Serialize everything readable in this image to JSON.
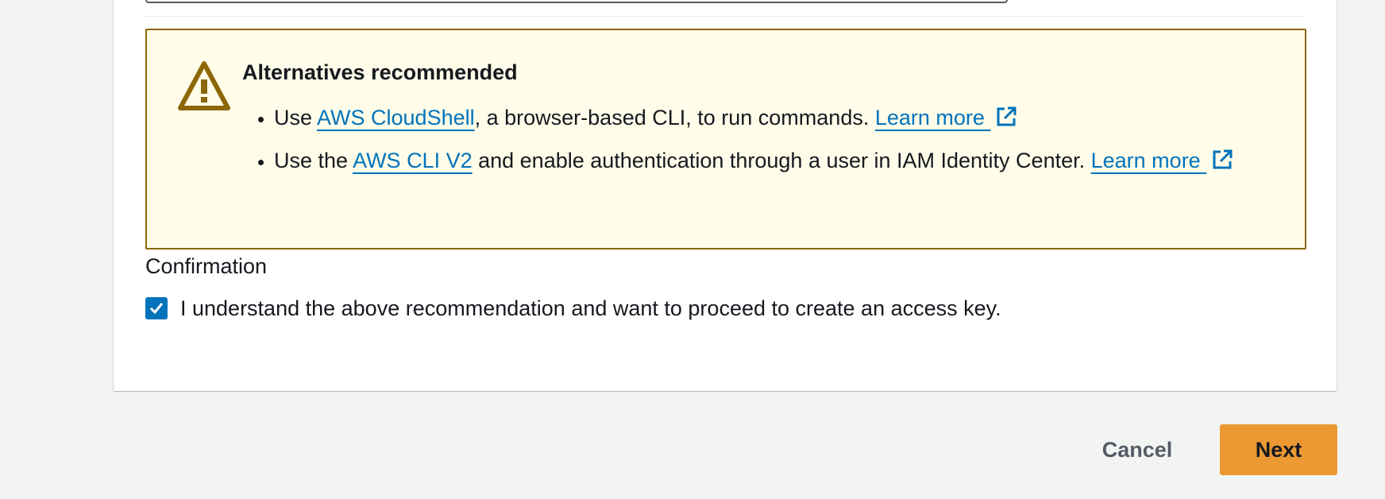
{
  "alert": {
    "icon": "warning-icon",
    "title": "Alternatives recommended",
    "item1": {
      "prefix": "Use ",
      "link": "AWS CloudShell",
      "suffix": ", a browser-based CLI, to run commands. ",
      "learn_more": "Learn more"
    },
    "item2": {
      "prefix": "Use the ",
      "link": "AWS CLI V2",
      "suffix": " and enable authentication through a user in IAM Identity Center. ",
      "learn_more": "Learn more"
    },
    "colors": {
      "background": "#fffce9",
      "border": "#8d6605",
      "link": "#0073bb"
    }
  },
  "confirmation": {
    "label": "Confirmation",
    "checkbox_checked": true,
    "checkbox_text": "I understand the above recommendation and want to proceed to create an access key."
  },
  "footer": {
    "cancel_label": "Cancel",
    "next_label": "Next",
    "primary_color": "#ec9933"
  }
}
